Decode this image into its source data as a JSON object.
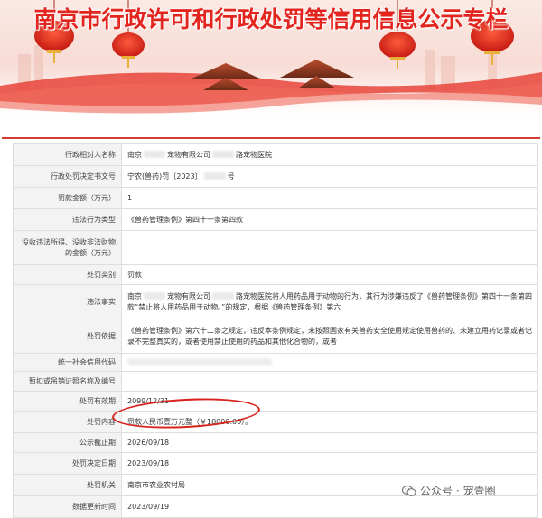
{
  "banner": {
    "title": "南京市行政许可和行政处罚等信用信息公示专栏"
  },
  "rows": [
    {
      "label": "行政相对人名称",
      "value_parts": [
        "南京",
        "宠物有限公司",
        "路宠物医院"
      ]
    },
    {
      "label": "行政处罚决定书文号",
      "value_parts": [
        "宁农(兽药)罚〔2023〕",
        "号"
      ]
    },
    {
      "label": "罚款金额（万元）",
      "value": "1"
    },
    {
      "label": "违法行为类型",
      "value": "《兽药管理条例》第四十一条第四款"
    },
    {
      "label": "没收违法所得、没收非法财物的金额（万元）",
      "value": ""
    },
    {
      "label": "处罚类别",
      "value": "罚款"
    },
    {
      "label": "违法事实",
      "value_parts": [
        "南京",
        "宠物有限公司",
        "路宠物医院将人用药品用于动物的行为，其行为涉嫌违反了《兽药管理条例》第四十一条第四款“禁止将人用药品用于动物。”的规定，根据《兽药管理条例》第六"
      ]
    },
    {
      "label": "处罚依据",
      "value": "《兽药管理条例》第六十二条之规定，违反本条例规定，未按照国家有关兽药安全使用规定使用兽药的、未建立用药记录或者记录不完整真实的，或者使用禁止使用的药品和其他化合物的，或者"
    },
    {
      "label": "统一社会信用代码",
      "value": ""
    },
    {
      "label": "暂扣或吊销证照名称及编号",
      "value": ""
    },
    {
      "label": "处罚有效期",
      "value": "2099/12/31"
    },
    {
      "label": "处罚内容",
      "value": "罚款人民币壹万元整（￥10000.00）。"
    },
    {
      "label": "公示截止期",
      "value": "2026/09/18"
    },
    {
      "label": "处罚决定日期",
      "value": "2023/09/18"
    },
    {
      "label": "处罚机关",
      "value": "南京市农业农村局"
    },
    {
      "label": "数据更新时间",
      "value": "2023/09/19"
    }
  ],
  "watermark": {
    "text": "公众号 · 宠壹圈"
  },
  "colors": {
    "title_red": "#e2261f",
    "rule_red": "#d43a32",
    "label_bg": "#f3f3f3",
    "border": "#dedede"
  }
}
